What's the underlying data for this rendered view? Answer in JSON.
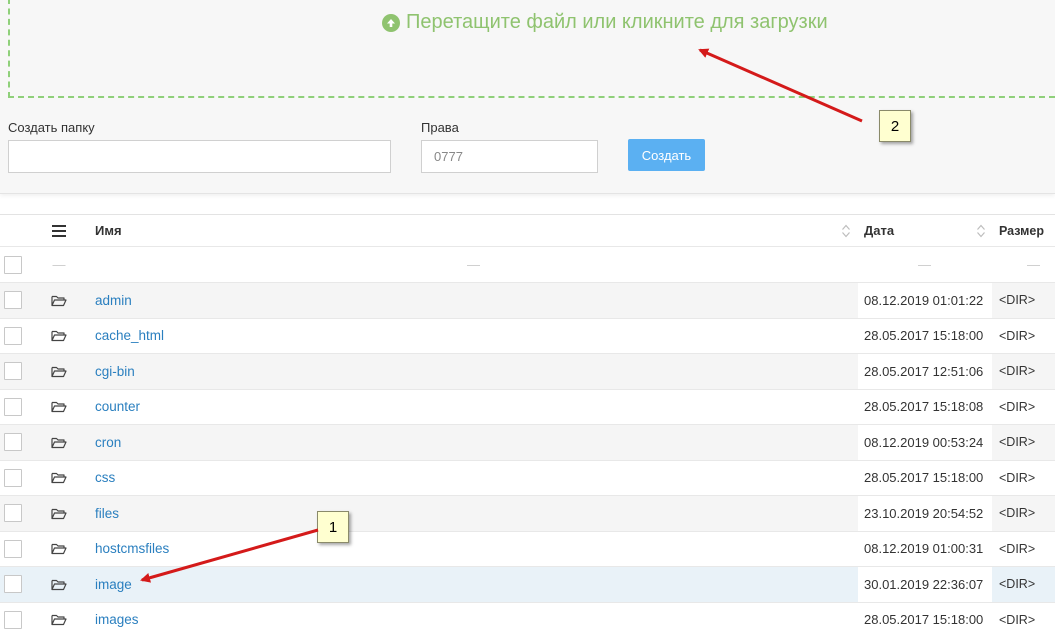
{
  "upload": {
    "text": "Перетащите файл или кликните для загрузки"
  },
  "form": {
    "folder_label": "Создать папку",
    "folder_value": "",
    "rights_label": "Права",
    "rights_placeholder": "0777",
    "create_label": "Создать"
  },
  "table": {
    "headers": {
      "name": "Имя",
      "date": "Дата",
      "size": "Размер"
    },
    "placeholder_dash": "—",
    "rows": [
      {
        "name": "admin",
        "date": "08.12.2019 01:01:22",
        "size": "<DIR>"
      },
      {
        "name": "cache_html",
        "date": "28.05.2017 15:18:00",
        "size": "<DIR>"
      },
      {
        "name": "cgi-bin",
        "date": "28.05.2017 12:51:06",
        "size": "<DIR>"
      },
      {
        "name": "counter",
        "date": "28.05.2017 15:18:08",
        "size": "<DIR>"
      },
      {
        "name": "cron",
        "date": "08.12.2019 00:53:24",
        "size": "<DIR>"
      },
      {
        "name": "css",
        "date": "28.05.2017 15:18:00",
        "size": "<DIR>"
      },
      {
        "name": "files",
        "date": "23.10.2019 20:54:52",
        "size": "<DIR>"
      },
      {
        "name": "hostcmsfiles",
        "date": "08.12.2019 01:00:31",
        "size": "<DIR>"
      },
      {
        "name": "image",
        "date": "30.01.2019 22:36:07",
        "size": "<DIR>"
      },
      {
        "name": "images",
        "date": "28.05.2017 15:18:00",
        "size": "<DIR>"
      }
    ]
  },
  "annotations": {
    "callout_1": "1",
    "callout_2": "2"
  },
  "colors": {
    "accent_green": "#8fc36f",
    "link_blue": "#2a7fbf",
    "button_blue": "#5bb0f2",
    "annotation_red": "#d41a1a"
  }
}
